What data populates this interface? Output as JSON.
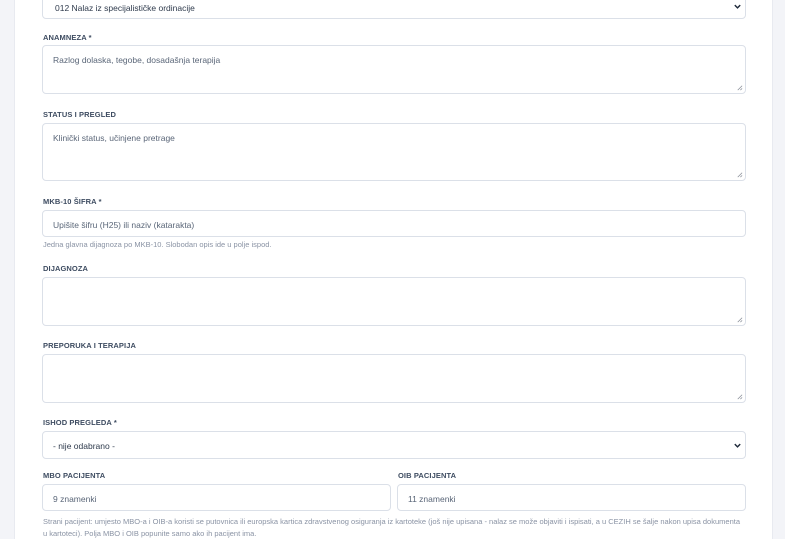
{
  "document_type": {
    "selected": "012 Nalaz iz specijalističke ordinacije"
  },
  "anamneza": {
    "label": "ANAMNEZA *",
    "placeholder": "Razlog dolaska, tegobe, dosadašnja terapija"
  },
  "status": {
    "label": "STATUS I PREGLED",
    "placeholder": "Klinički status, učinjene pretrage"
  },
  "mkb": {
    "label": "MKB-10 ŠIFRA *",
    "placeholder": "Upišite šifru (H25) ili naziv (katarakta)",
    "help": "Jedna glavna dijagnoza po MKB-10. Slobodan opis ide u polje ispod."
  },
  "dijagnoza": {
    "label": "DIJAGNOZA",
    "placeholder": ""
  },
  "preporuka": {
    "label": "PREPORUKA I TERAPIJA",
    "placeholder": ""
  },
  "ishod": {
    "label": "ISHOD PREGLEDA *",
    "selected": "- nije odabrano -"
  },
  "mbo": {
    "label": "MBO PACIJENTA",
    "placeholder": "9 znamenki"
  },
  "oib": {
    "label": "OIB PACIJENTA",
    "placeholder": "11 znamenki"
  },
  "foreign_note": "Strani pacijent: umjesto MBO-a i OIB-a koristi se putovnica ili europska kartica zdravstvenog osiguranja iz kartoteke (još nije upisana - nalaz se može objaviti i ispisati, a u CEZIH se šalje nakon upisa dokumenta u kartoteci). Polja MBO i OIB popunite samo ako ih pacijent ima.",
  "colors": {
    "border": "#dbe0e8",
    "label": "#3e4c61",
    "help": "#8a93a4",
    "background": "#f3f4f8"
  }
}
